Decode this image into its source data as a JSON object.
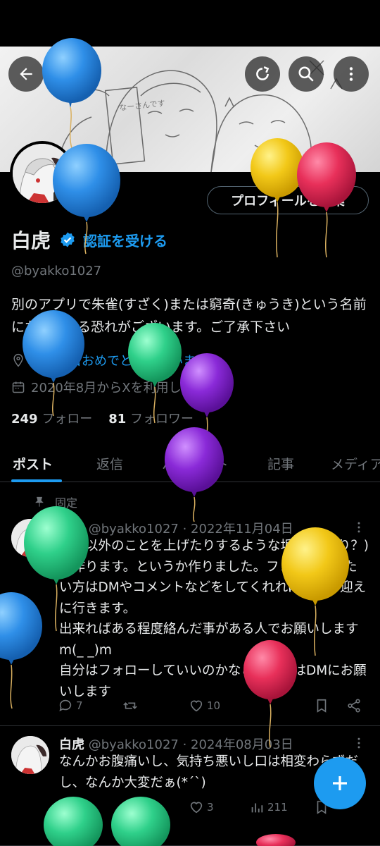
{
  "header": {
    "back_icon": "arrow-left-icon",
    "refresh_icon": "refresh-icon",
    "search_icon": "search-icon",
    "more_icon": "more-vertical-icon"
  },
  "profile": {
    "display_name": "白虎",
    "verify_label": "認証を受ける",
    "handle": "@byakko1027",
    "bio": "別のアプリで朱雀(すざく)または窮奇(きゅうき)という名前になっている恐れがございます。ご了承下さい",
    "birthday": "お誕生日おめでとうございます。",
    "joined": "2020年8月からXを利用しています",
    "following_count": "249",
    "following_label": "フォロー",
    "followers_count": "81",
    "followers_label": "フォロワー",
    "edit_button": "プロフィールを編集"
  },
  "tabs": [
    "ポスト",
    "返信",
    "ハイライト",
    "記事",
    "メディア"
  ],
  "pinned_label": "固定",
  "posts": [
    {
      "name": "白虎",
      "meta": "@byakko1027 · 2022年11月04日",
      "text": "配信以外のことを上げたりするような垢(実写あり？)を作ります。というか作りました。フォローをしたい方はDMやコメントなどをしてくれれば自分が迎えに行きます。\n出来ればある程度絡んだ事がある人でお願いしますm(_ _)m\n自分はフォローしていいのかなどの質問はDMにお願いします",
      "replies": "7",
      "likes": "10"
    },
    {
      "name": "白虎",
      "meta": "@byakko1027 · 2024年08月03日",
      "text": "なんかお腹痛いし、気持ち悪いし口は相変わらずだし、なんか大変だぁ(*´`)",
      "likes": "3",
      "views": "211"
    }
  ],
  "colors": {
    "accent": "#1d9bf0",
    "background": "#000000",
    "text": "#e7e9ea",
    "muted": "#71767b",
    "balloon_blue": "#2f8fe8",
    "balloon_yellow": "#f2c818",
    "balloon_red": "#e8305a",
    "balloon_green": "#2fd08a",
    "balloon_purple": "#8a2ad8"
  }
}
